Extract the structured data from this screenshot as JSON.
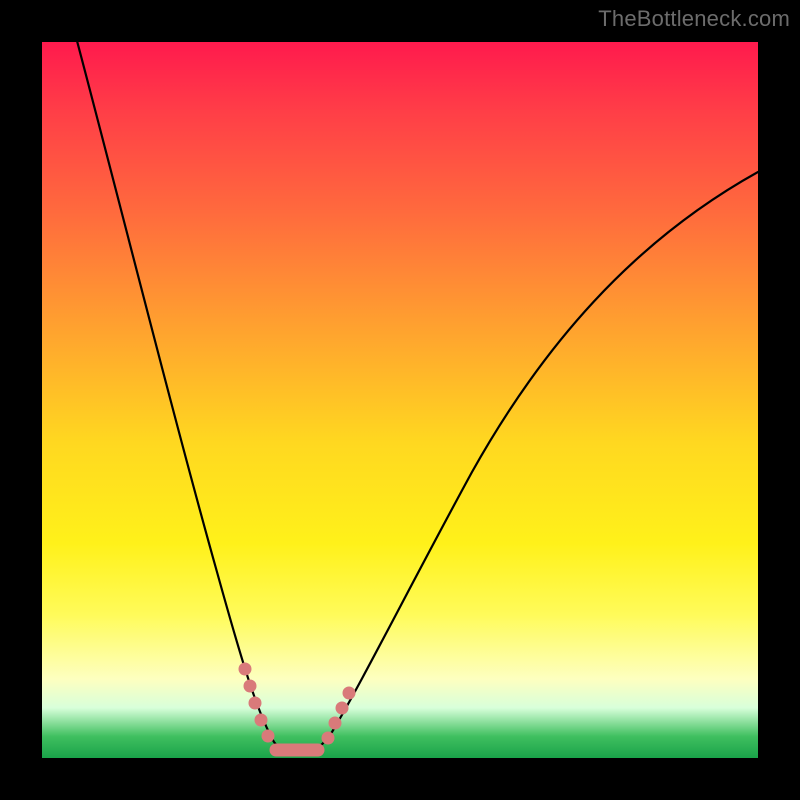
{
  "watermark": "TheBottleneck.com",
  "chart_data": {
    "type": "line",
    "title": "",
    "xlabel": "",
    "ylabel": "",
    "x": [
      0.0,
      0.05,
      0.1,
      0.15,
      0.2,
      0.25,
      0.3,
      0.32,
      0.34,
      0.36,
      0.4,
      0.45,
      0.5,
      0.55,
      0.6,
      0.65,
      0.7,
      0.75,
      0.8,
      0.85,
      0.9,
      0.95,
      1.0
    ],
    "y": [
      1.0,
      0.82,
      0.64,
      0.47,
      0.31,
      0.17,
      0.05,
      0.02,
      0.0,
      0.02,
      0.07,
      0.15,
      0.23,
      0.31,
      0.39,
      0.46,
      0.53,
      0.59,
      0.64,
      0.69,
      0.73,
      0.77,
      0.8
    ],
    "xlim": [
      0,
      1
    ],
    "ylim": [
      0,
      1
    ],
    "grid": false,
    "background_gradient": [
      "#ff1a4d",
      "#ffd820",
      "#fff11a",
      "#1aa34a"
    ],
    "optimal_range_x": [
      0.27,
      0.42
    ],
    "optimal_marker_color": "#d97a7a",
    "curve_color": "#000000",
    "annotations": []
  }
}
